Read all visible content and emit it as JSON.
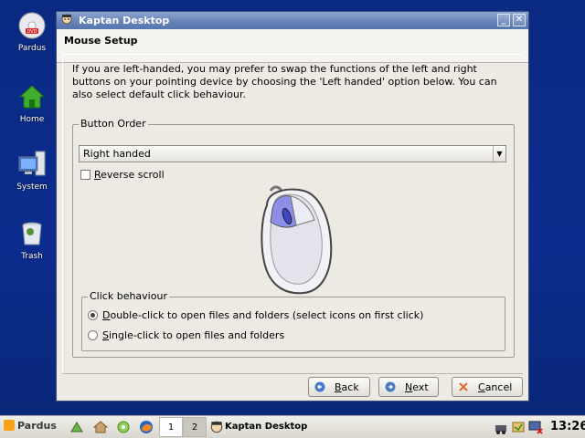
{
  "desktop": {
    "icons": [
      {
        "label": "Pardus",
        "icon": "dvd-icon"
      },
      {
        "label": "Home",
        "icon": "home-icon"
      },
      {
        "label": "System",
        "icon": "computer-icon"
      },
      {
        "label": "Trash",
        "icon": "trash-icon"
      }
    ]
  },
  "window": {
    "title": "Kaptan Desktop",
    "minimize_label": "_",
    "close_label": "✕",
    "page_title": "Mouse Setup",
    "intro_text": "If you are left-handed, you may prefer to swap the functions of the left and right buttons on your pointing device by choosing the 'Left handed' option below. You can also select default click behaviour."
  },
  "button_order": {
    "group_label": "Button Order",
    "combo_value": "Right handed",
    "reverse_scroll_label_prefix": "",
    "reverse_scroll_accel": "R",
    "reverse_scroll_rest": "everse scroll",
    "reverse_scroll_checked": false
  },
  "click_behaviour": {
    "group_label": "Click behaviour",
    "options": [
      {
        "accel": "D",
        "rest": "ouble-click to open files and folders (select icons on first click)",
        "selected": true
      },
      {
        "accel": "S",
        "rest": "ingle-click to open files and folders",
        "selected": false
      }
    ]
  },
  "buttons": {
    "back_accel": "B",
    "back_rest": "ack",
    "next_accel": "N",
    "next_rest": "ext",
    "cancel_accel": "C",
    "cancel_rest": "ancel"
  },
  "taskbar": {
    "logo_text": "Pardus",
    "desktop_1": "1",
    "desktop_2": "2",
    "task_title": "Kaptan Desktop",
    "clock": "13:26"
  },
  "colors": {
    "desktop_bg": "#0b2a82",
    "titlebar": "#6a86bb",
    "window_bg": "#eceae3"
  }
}
